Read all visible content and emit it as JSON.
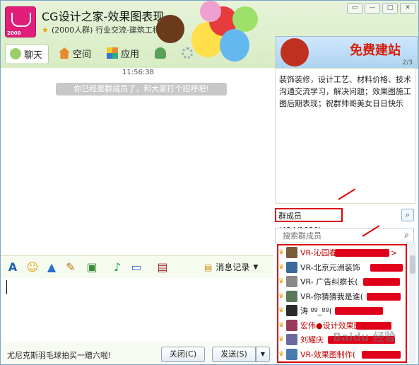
{
  "window": {
    "title": "CG设计之家-效果图表现",
    "member_count_label": "(2000人群)",
    "group_category": "行业交流-建筑工程",
    "avatar_label": "2000"
  },
  "tabs": [
    {
      "label": "聊天",
      "icon": "chat-bubble-icon"
    },
    {
      "label": "空间",
      "icon": "house-icon"
    },
    {
      "label": "应用",
      "icon": "apps-grid-icon"
    }
  ],
  "banner": {
    "text": "免费建站",
    "page": "2/3"
  },
  "chat": {
    "timestamp": "11:56:38",
    "system_notice": "你已经是群成员了，和大家打个招呼吧!"
  },
  "toolbar": {
    "message_history_label": "消息记录"
  },
  "bottom": {
    "ad_text": "尤尼克斯羽毛球拍买一赠六啦!",
    "close_label": "关闭(C)",
    "send_label": "发送(S)"
  },
  "announcement": {
    "text": "装饰装修，设计工艺、材料价格、技术沟通交流学习，解决问题；效果图施工图后期表现；祝群帅哥美女日日快乐"
  },
  "members": {
    "title": "群成员(424/1010)",
    "search_placeholder": "搜索群成员",
    "list": [
      {
        "name": "VR-沁园春<",
        "suffix": ">",
        "color": "#c00000"
      },
      {
        "name": "VR-北京元洲装饰",
        "suffix": "",
        "color": "#222222"
      },
      {
        "name": "VR- 广告纠察长(",
        "suffix": "",
        "color": "#222222"
      },
      {
        "name": "VR-你猜猜我是谁(",
        "suffix": "",
        "color": "#222222"
      },
      {
        "name": "涛 ºº_ºº(",
        "suffix": "",
        "color": "#222222"
      },
      {
        "name": "宏伟●设计效果图(",
        "suffix": "",
        "color": "#c00000"
      },
      {
        "name": "刘耀庆",
        "suffix": "",
        "color": "#c00000"
      },
      {
        "name": "VR-效果图制作(",
        "suffix": "",
        "color": "#c00000"
      }
    ]
  },
  "watermark": "Baidu 经验"
}
